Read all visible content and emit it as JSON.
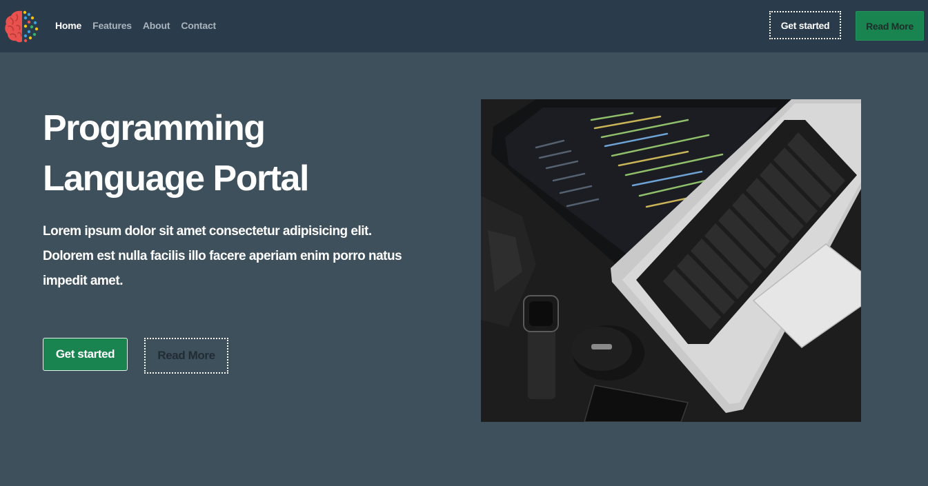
{
  "navbar": {
    "logo_icon": "brain-icon",
    "links": [
      {
        "label": "Home",
        "active": true
      },
      {
        "label": "Features",
        "active": false
      },
      {
        "label": "About",
        "active": false
      },
      {
        "label": "Contact",
        "active": false
      }
    ],
    "get_started_label": "Get started",
    "read_more_label": "Read More"
  },
  "hero": {
    "title_line1": "Programming",
    "title_line2": "Language Portal",
    "text_line1": "Lorem ipsum dolor sit amet consectetur adipisicing elit.",
    "text_line2": "Dolorem est nulla facilis illo facere aperiam enim porro natus",
    "text_line3": "impedit amet.",
    "get_started_label": "Get started",
    "read_more_label": "Read More",
    "image_icon": "laptop-photo"
  },
  "colors": {
    "navbar_bg": "#2a3b4b",
    "page_bg": "#3d505c",
    "accent_green": "#1a8451"
  }
}
